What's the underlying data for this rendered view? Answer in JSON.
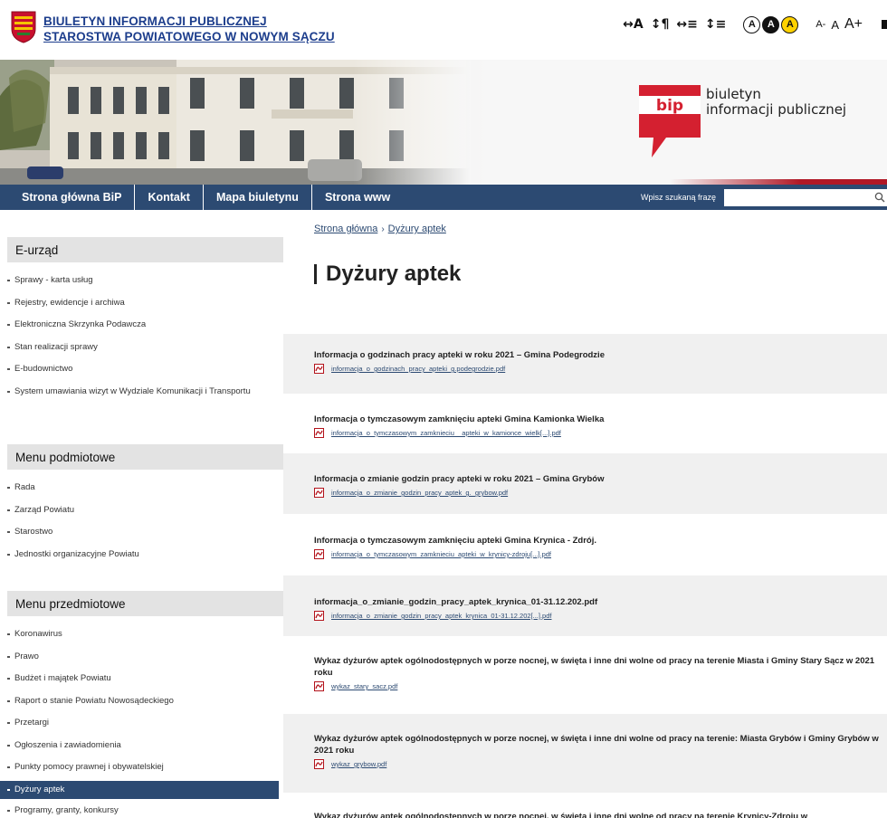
{
  "header": {
    "title_line1": "BIULETYN INFORMACJI PUBLICZNEJ",
    "title_line2": "STAROSTWA POWIATOWEGO W NOWYM SĄCZU",
    "a11y": {
      "letter_spacing": "↔A",
      "line_height": "↕¶",
      "word_spacing": "↔≡",
      "paragraph_spacing": "↕≡",
      "contrast_normal": "A",
      "contrast_dark": "A",
      "contrast_yellow": "A",
      "font_small": "A-",
      "font_normal": "A",
      "font_large": "A+"
    }
  },
  "banner": {
    "bip_line1": "biuletyn",
    "bip_line2": "informacji publicznej",
    "bip_mark": "bip"
  },
  "nav": {
    "items": [
      "Strona główna BiP",
      "Kontakt",
      "Mapa biuletynu",
      "Strona www"
    ],
    "search_label": "Wpisz szukaną frazę",
    "search_value": ""
  },
  "sidebar": {
    "sections": [
      {
        "title": "E-urząd",
        "items": [
          "Sprawy - karta usług",
          "Rejestry, ewidencje i archiwa",
          "Elektroniczna Skrzynka Podawcza",
          "Stan realizacji sprawy",
          "E-budownictwo",
          "System umawiania wizyt w Wydziale Komunikacji i Transportu"
        ]
      },
      {
        "title": "Menu podmiotowe",
        "items": [
          "Rada",
          "Zarząd Powiatu",
          "Starostwo",
          "Jednostki organizacyjne Powiatu"
        ]
      },
      {
        "title": "Menu przedmiotowe",
        "items": [
          "Koronawirus",
          "Prawo",
          "Budżet i majątek Powiatu",
          "Raport o stanie Powiatu Nowosądeckiego",
          "Przetargi",
          "Ogłoszenia i zawiadomienia",
          "Punkty pomocy prawnej i obywatelskiej",
          "Dyżury aptek",
          "Programy, granty, konkursy"
        ],
        "active_index": 7
      }
    ]
  },
  "main": {
    "breadcrumb": [
      "Strona główna",
      "Dyżury aptek"
    ],
    "breadcrumb_sep": "›",
    "title": "Dyżury aptek",
    "entries": [
      {
        "title": "Informacja o godzinach pracy apteki w roku 2021 – Gmina Podegrodzie",
        "file": "informacja_o_godzinach_pracy_apteki_g.podegrodzie.pdf"
      },
      {
        "title": "Informacja o tymczasowym zamknięciu apteki Gmina Kamionka Wielka",
        "file": "informacja_o_tymczasowym_zamknieciu__apteki_w_kamionce_wielk[...].pdf"
      },
      {
        "title": "Informacja o zmianie godzin pracy apteki w roku 2021 – Gmina Grybów",
        "file": "informacja_o_zmianie_godzin_pracy_aptek_g._grybow.pdf"
      },
      {
        "title": "Informacja o tymczasowym zamknięciu apteki Gmina Krynica - Zdrój.",
        "file": "informacja_o_tymczasowym_zamknieciu_apteki_w_krynicy-zdroju[...].pdf"
      },
      {
        "title": "informacja_o_zmianie_godzin_pracy_aptek_krynica_01-31.12.202.pdf",
        "file": "informacja_o_zmianie_godzin_pracy_aptek_krynica_01-31.12.202[...].pdf"
      },
      {
        "title": "Wykaz dyżurów aptek ogólnodostępnych w porze nocnej, w święta i inne dni wolne od pracy na terenie Miasta i Gminy Stary Sącz w 2021 roku",
        "file": "wykaz_stary_sacz.pdf"
      },
      {
        "title": "Wykaz dyżurów aptek ogólnodostępnych w porze nocnej, w święta i inne dni wolne od pracy na terenie: Miasta Grybów i Gminy Grybów w 2021 roku",
        "file": "wykaz_grybow.pdf"
      },
      {
        "title": "Wykaz dyżurów aptek ogólnodostępnych w porze nocnej, w święta i inne dni wolne od pracy na terenie Krynicy-Zdroju w",
        "file": ""
      }
    ]
  },
  "colors": {
    "nav": "#2c4a72",
    "link": "#1c3d8c",
    "bip_red": "#d42030",
    "stripe_alt": "#f0f0f0",
    "sidebar_head": "#e3e3e3"
  },
  "icons": [
    "crest-icon",
    "pdf-icon",
    "search-icon",
    "bip-logo-icon"
  ]
}
